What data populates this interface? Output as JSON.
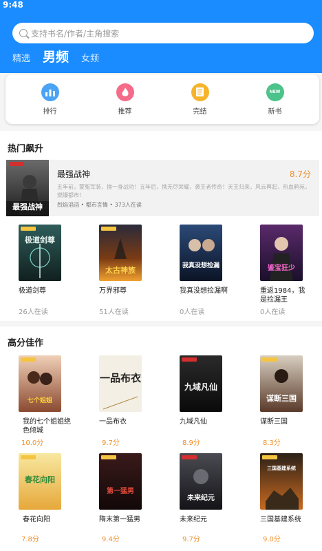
{
  "status": {
    "time": "9:48"
  },
  "search": {
    "placeholder": "支持书名/作者/主角搜索"
  },
  "tabs": [
    "精选",
    "男频",
    "女频"
  ],
  "quick": [
    {
      "label": "排行",
      "icon": "ranking-icon",
      "color": "#4ba3f5"
    },
    {
      "label": "推荐",
      "icon": "recommend-icon",
      "color": "#f56b8a"
    },
    {
      "label": "完结",
      "icon": "completed-icon",
      "color": "#f5b42a"
    },
    {
      "label": "新书",
      "icon": "new-book-icon",
      "color": "#4cc38a",
      "badge": "NEW"
    }
  ],
  "hot": {
    "title": "热门飙升",
    "featured": {
      "title": "最强战神",
      "score": "8.7分",
      "desc": "五年前，蒙冤军装，换一身战功！五年后，携无尽荣耀，袭王者传奇！天王归来，风云再起，热血鹤苑，燃爆都市！",
      "meta": "烈焰滔滔 • 都市言情 • 373人在读",
      "cover_text": "最强战神"
    },
    "books": [
      {
        "title": "极道剑尊",
        "readers": "26人在读",
        "cover_text": "极道剑尊"
      },
      {
        "title": "万界邪尊",
        "readers": "51人在读",
        "cover_text": "太古神族"
      },
      {
        "title": "我真没想捡漏啊",
        "readers": "0人在读",
        "cover_text": "我真没想捡漏"
      },
      {
        "title": "重返1984，我是捡漏王",
        "readers": "0人在读",
        "cover_text": "鉴宝狂少"
      }
    ]
  },
  "top": {
    "title": "高分佳作",
    "books": [
      {
        "title": "我的七个姐姐绝色倾城",
        "score": "10.0分",
        "cover_text": "七个姐姐"
      },
      {
        "title": "一品布衣",
        "score": "9.7分",
        "cover_text": "一品布衣"
      },
      {
        "title": "九域凡仙",
        "score": "8.9分",
        "cover_text": "九域凡仙"
      },
      {
        "title": "谋断三国",
        "score": "8.3分",
        "cover_text": "谋断三国"
      },
      {
        "title": "春花向阳",
        "score": "7.8分",
        "cover_text": "春花向阳"
      },
      {
        "title": "隋末第一猛男",
        "score": "9.4分",
        "cover_text": "第一猛男"
      },
      {
        "title": "未来纪元",
        "score": "9.7分",
        "cover_text": "未来纪元"
      },
      {
        "title": "三国基建系统",
        "score": "9.0分",
        "cover_text": "三国基建系统"
      }
    ]
  }
}
